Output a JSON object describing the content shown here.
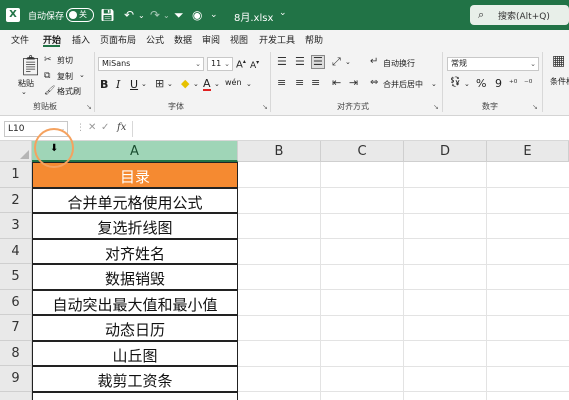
{
  "titlebar": {
    "autosave_label": "自动保存",
    "autosave_state": "关",
    "filename": "8月.xlsx",
    "filename_caret": "⌄",
    "search_placeholder": "搜索(Alt+Q)",
    "icons": [
      "save-icon",
      "undo-icon",
      "redo-icon",
      "filter-icon",
      "camera-icon",
      "more-icon"
    ]
  },
  "menu": {
    "tabs": [
      "文件",
      "开始",
      "插入",
      "页面布局",
      "公式",
      "数据",
      "审阅",
      "视图",
      "开发工具",
      "帮助"
    ],
    "active_tab": "开始"
  },
  "ribbon": {
    "clipboard": {
      "paste": "粘贴",
      "cut": "剪切",
      "copy": "复制",
      "format_painter": "格式刷",
      "group": "剪贴板"
    },
    "font": {
      "name": "MiSans",
      "size": "11",
      "bold": "B",
      "italic": "I",
      "underline": "U",
      "grow": "A",
      "shrink": "A",
      "font_color": "A",
      "fill_icon": "◆",
      "wen": "wén",
      "group": "字体"
    },
    "alignment": {
      "wrap": "自动换行",
      "merge": "合并后居中",
      "group": "对齐方式"
    },
    "number": {
      "format": "常规",
      "percent": "%",
      "comma": "9",
      "group": "数字"
    },
    "styles": {
      "cond_format": "条件格"
    }
  },
  "formula_bar": {
    "name_box": "L10",
    "cancel": "✕",
    "enter": "✓",
    "fx": "fx",
    "value": ""
  },
  "sheet": {
    "columns": [
      "A",
      "B",
      "C",
      "D",
      "E"
    ],
    "selected_column": "A",
    "rows": [
      "1",
      "2",
      "3",
      "4",
      "5",
      "6",
      "7",
      "8",
      "9"
    ],
    "cells_a": [
      "目录",
      "合并单元格使用公式",
      "复选折线图",
      "对齐姓名",
      "数据销毁",
      "自动突出最大值和最小值",
      "动态日历",
      "山丘图",
      "裁剪工资条"
    ],
    "header_fill": "#f58a31",
    "selected_header_fill": "#9fd5b7"
  },
  "colors": {
    "accent": "#217346"
  }
}
